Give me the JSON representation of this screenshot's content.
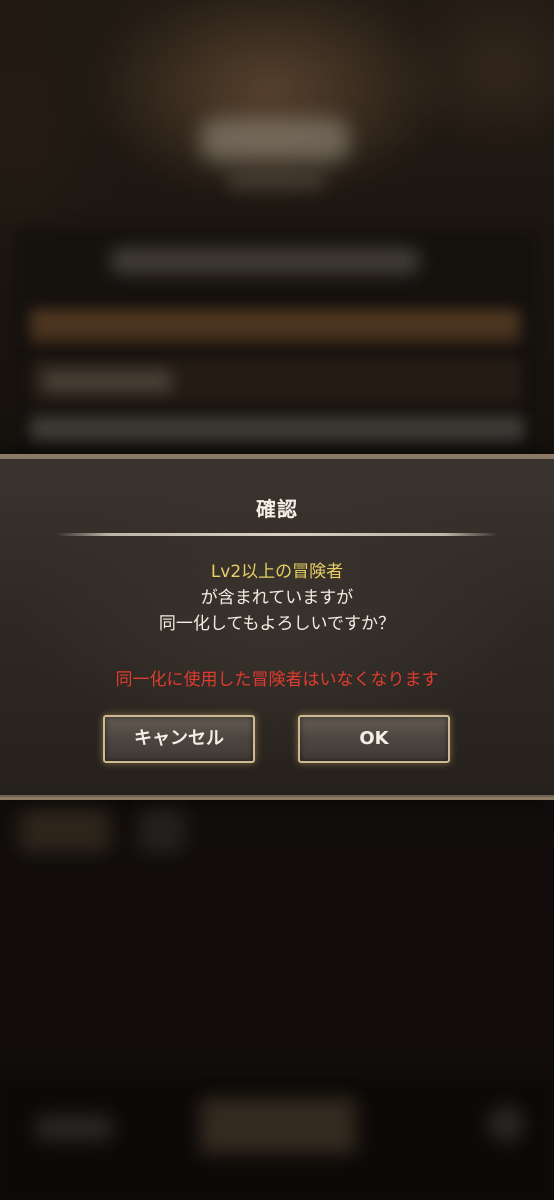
{
  "dialog": {
    "title": "確認",
    "message_line1": "Lv2以上の冒険者",
    "message_line2": "が含まれていますが",
    "message_line3": "同一化してもよろしいですか？",
    "warning": "同一化に使用した冒険者はいなくなります",
    "cancel_label": "キャンセル",
    "ok_label": "OK"
  },
  "colors": {
    "highlight_text": "#e6cf63",
    "warning_text": "#e03b2f",
    "button_border": "#cfb992",
    "dialog_border": "#8d7a63"
  }
}
